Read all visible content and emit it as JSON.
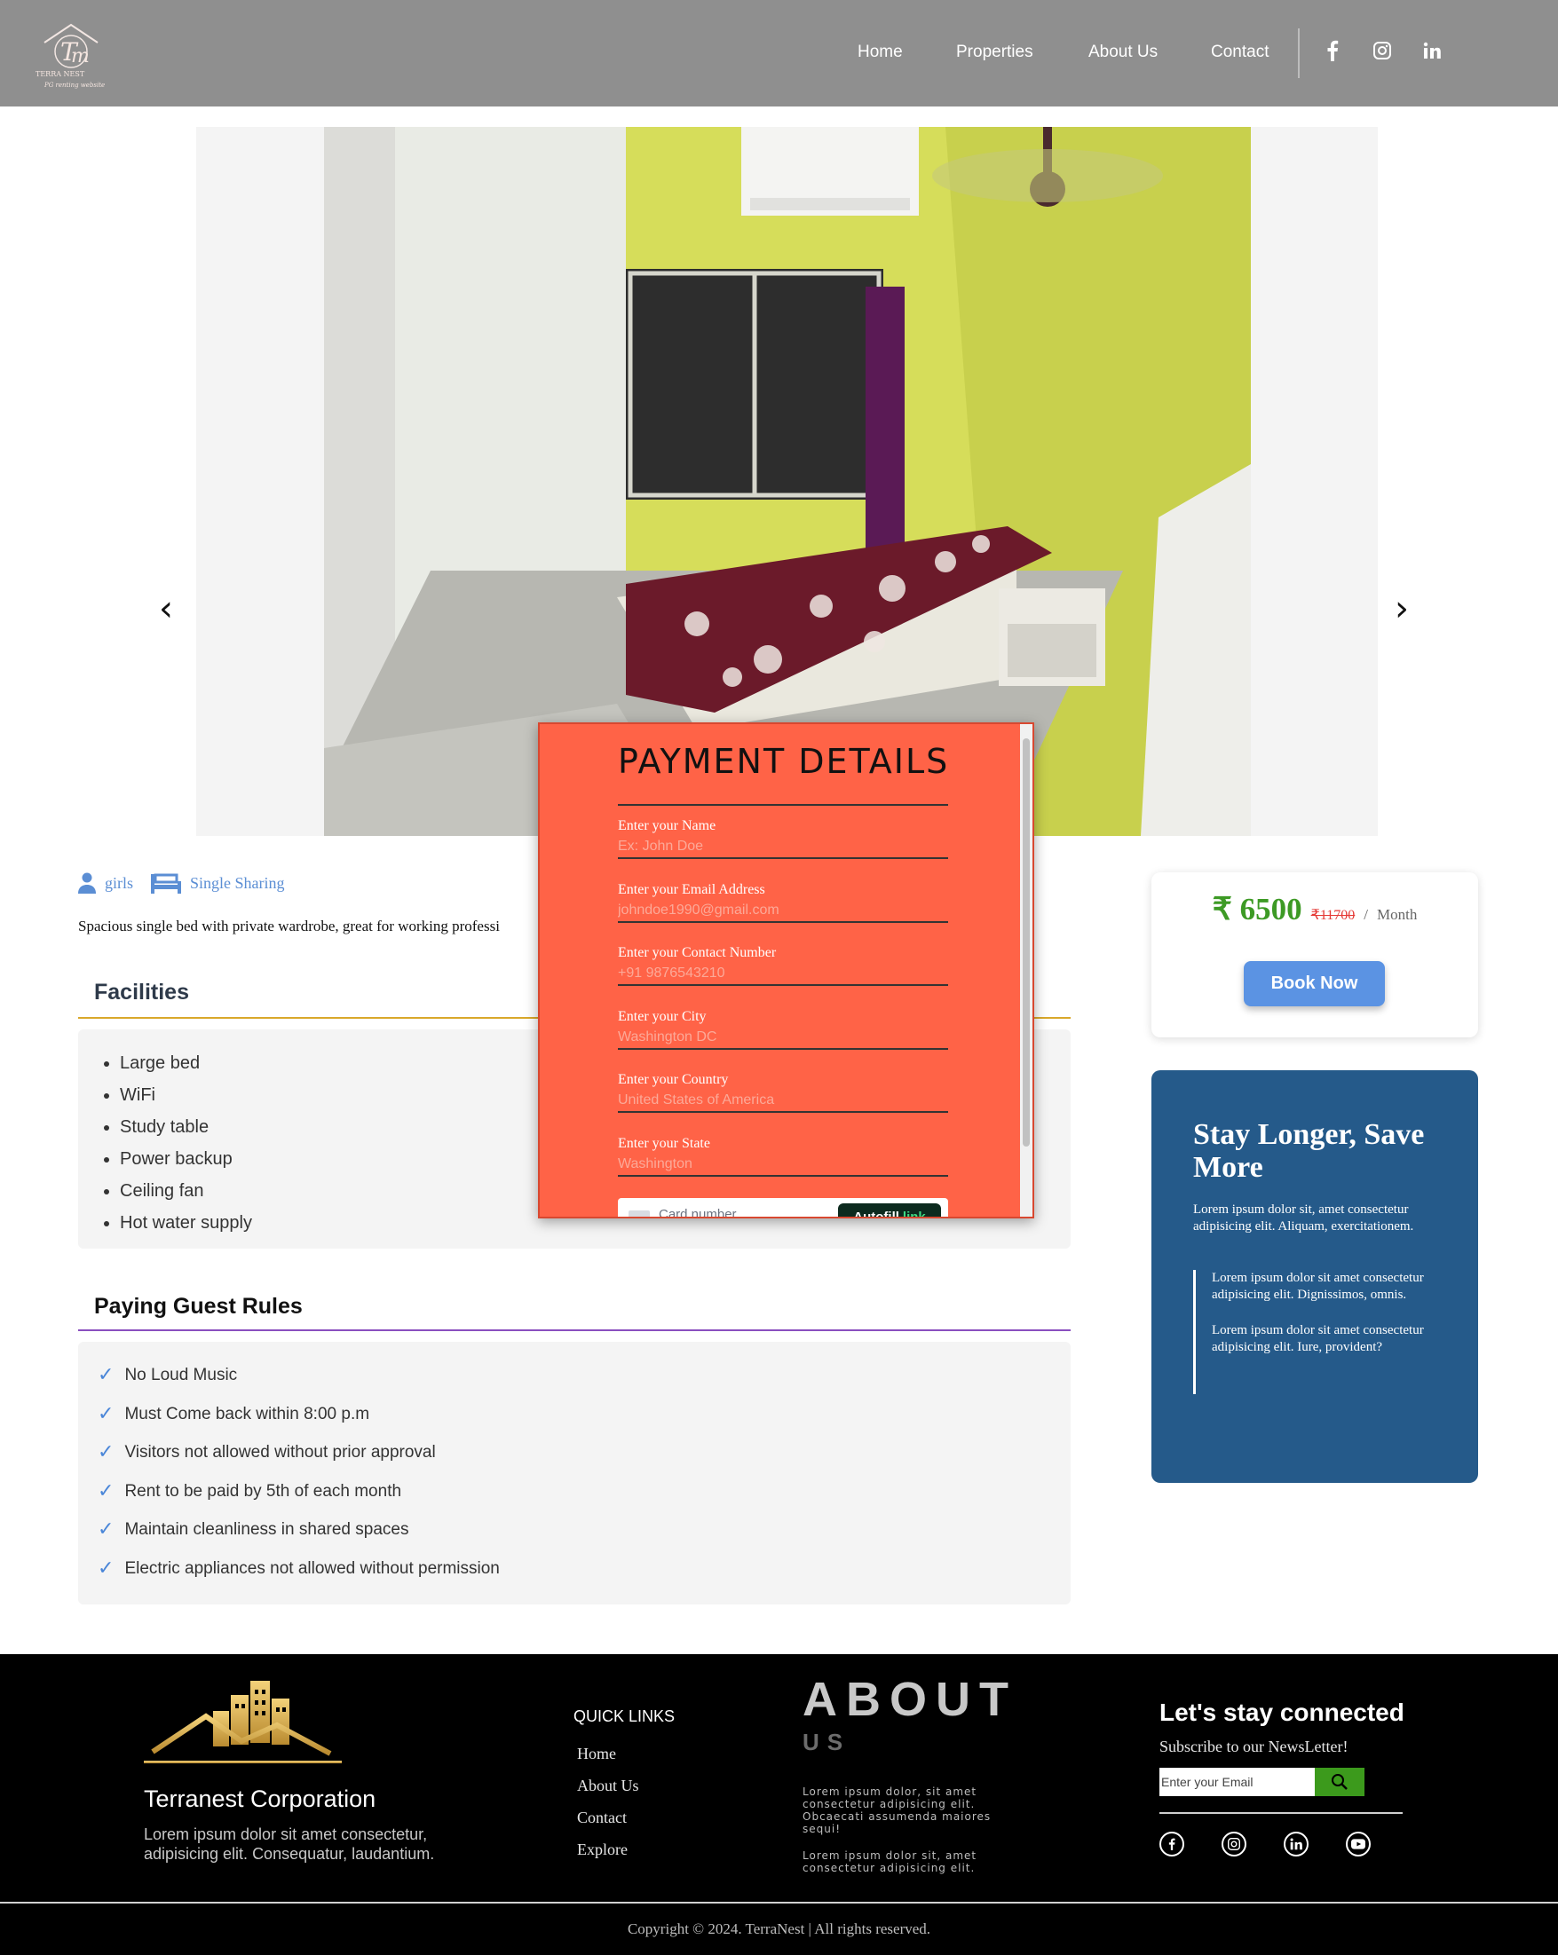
{
  "header": {
    "nav": [
      {
        "label": "Home"
      },
      {
        "label": "Properties"
      },
      {
        "label": "About Us"
      },
      {
        "label": "Contact"
      }
    ],
    "social_icons": [
      "facebook-icon",
      "instagram-icon",
      "linkedin-icon"
    ]
  },
  "carousel": {
    "prev_label": "‹",
    "next_label": "›"
  },
  "listing": {
    "gender": "girls",
    "sharing": "Single Sharing",
    "description": "Spacious single bed with private wardrobe, great for working professi"
  },
  "facilities": {
    "title": "Facilities",
    "items": [
      "Large bed",
      "WiFi",
      "Study table",
      "Power backup",
      "Ceiling fan",
      "Hot water supply"
    ]
  },
  "rules": {
    "title": "Paying Guest Rules",
    "items": [
      "No Loud Music",
      "Must Come back within 8:00 p.m",
      "Visitors not allowed without prior approval",
      "Rent to be paid by 5th of each month",
      "Maintain cleanliness in shared spaces",
      "Electric appliances not allowed without permission"
    ]
  },
  "price_card": {
    "price": "₹ 6500",
    "old_price": "₹11700",
    "separator": "/",
    "period": "Month",
    "book_label": "Book Now"
  },
  "stay_card": {
    "title": "Stay Longer, Save More",
    "text": "Lorem ipsum dolor sit, amet consectetur adipisicing elit. Aliquam, exercitationem.",
    "quotes": [
      "Lorem ipsum dolor sit amet consectetur adipisicing elit. Dignissimos, omnis.",
      "Lorem ipsum dolor sit amet consectetur adipisicing elit. Iure, provident?"
    ]
  },
  "payment_modal": {
    "title": "PAYMENT DETAILS",
    "fields": [
      {
        "label": "Enter your Name",
        "placeholder": "Ex: John Doe"
      },
      {
        "label": "Enter your Email Address",
        "placeholder": "johndoe1990@gmail.com"
      },
      {
        "label": "Enter your Contact Number",
        "placeholder": "+91 9876543210"
      },
      {
        "label": "Enter your City",
        "placeholder": "Washington DC"
      },
      {
        "label": "Enter your Country",
        "placeholder": "United States of America"
      },
      {
        "label": "Enter your State",
        "placeholder": "Washington"
      }
    ],
    "card_placeholder": "Card number",
    "autofill_label": "Autofill",
    "autofill_link": "link"
  },
  "footer": {
    "brand": "Terranest Corporation",
    "brand_text": "Lorem ipsum dolor sit amet consectetur, adipisicing elit. Consequatur, laudantium.",
    "quick_links_title": "QUICK LINKS",
    "quick_links": [
      "Home",
      "About Us",
      "Contact",
      "Explore"
    ],
    "about_title": "ABOUT",
    "about_sub": "US",
    "about_text_1": "Lorem ipsum dolor, sit amet consectetur adipisicing elit. Obcaecati assumenda maiores sequi!",
    "about_text_2": "Lorem ipsum dolor sit, amet consectetur adipisicing elit.",
    "connect_title": "Let's stay connected",
    "subscribe_text": "Subscribe to our NewsLetter!",
    "email_placeholder": "Enter your Email",
    "social_icons": [
      "facebook-icon",
      "instagram-icon",
      "linkedin-icon",
      "youtube-icon"
    ],
    "copyright": "Copyright © 2024. TerraNest | All rights reserved."
  },
  "colors": {
    "header_bg": "#8f8f8f",
    "modal_bg": "#ff6347",
    "accent_blue": "#5b93e3",
    "price_green": "#3d9a25",
    "stay_card_bg": "#255a8a",
    "facilities_rule": "#d9a82a",
    "rules_rule": "#8a4fbf"
  }
}
